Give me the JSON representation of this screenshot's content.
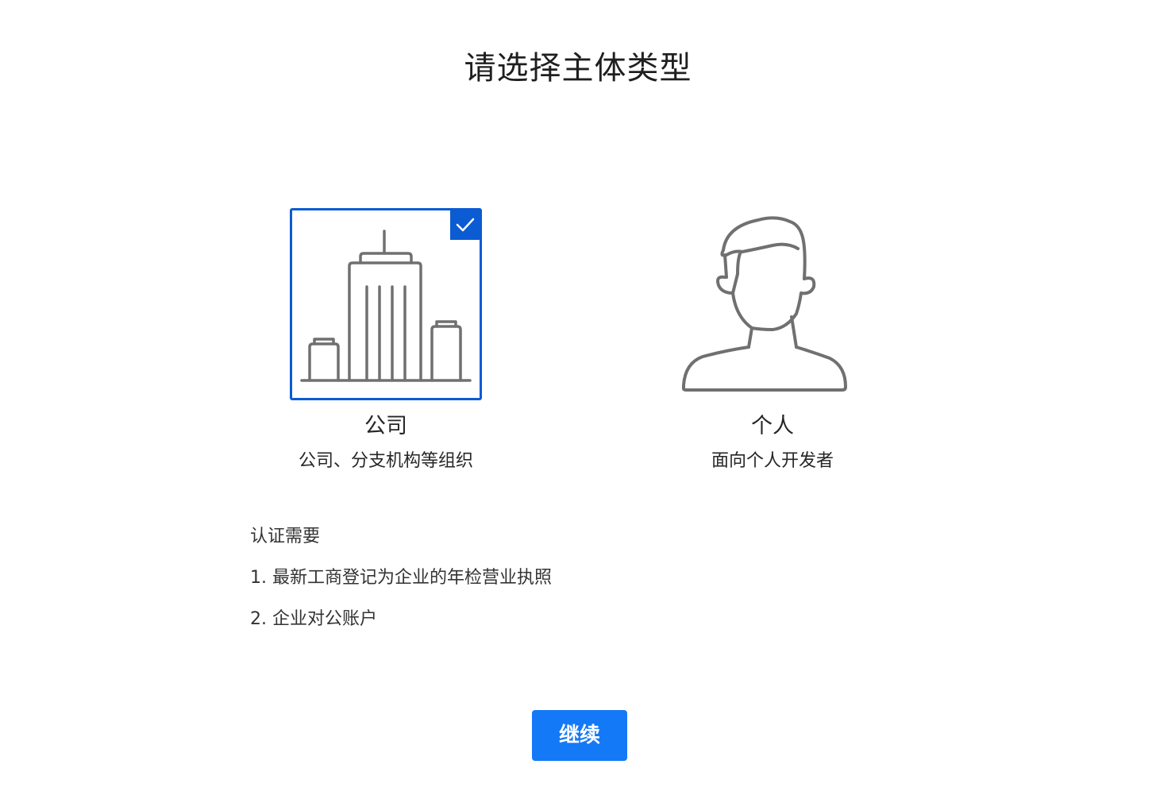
{
  "page": {
    "title": "请选择主体类型"
  },
  "options": [
    {
      "icon": "building-icon",
      "label": "公司",
      "description": "公司、分支机构等组织",
      "selected": true
    },
    {
      "icon": "person-icon",
      "label": "个人",
      "description": "面向个人开发者",
      "selected": false
    }
  ],
  "requirements": {
    "title": "认证需要",
    "items": [
      "1. 最新工商登记为企业的年检营业执照",
      "2. 企业对公账户"
    ]
  },
  "actions": {
    "continue_label": "继续"
  },
  "colors": {
    "selected_border": "#0b5bd3",
    "button_background": "#1479f7",
    "icon_stroke": "#707070"
  }
}
